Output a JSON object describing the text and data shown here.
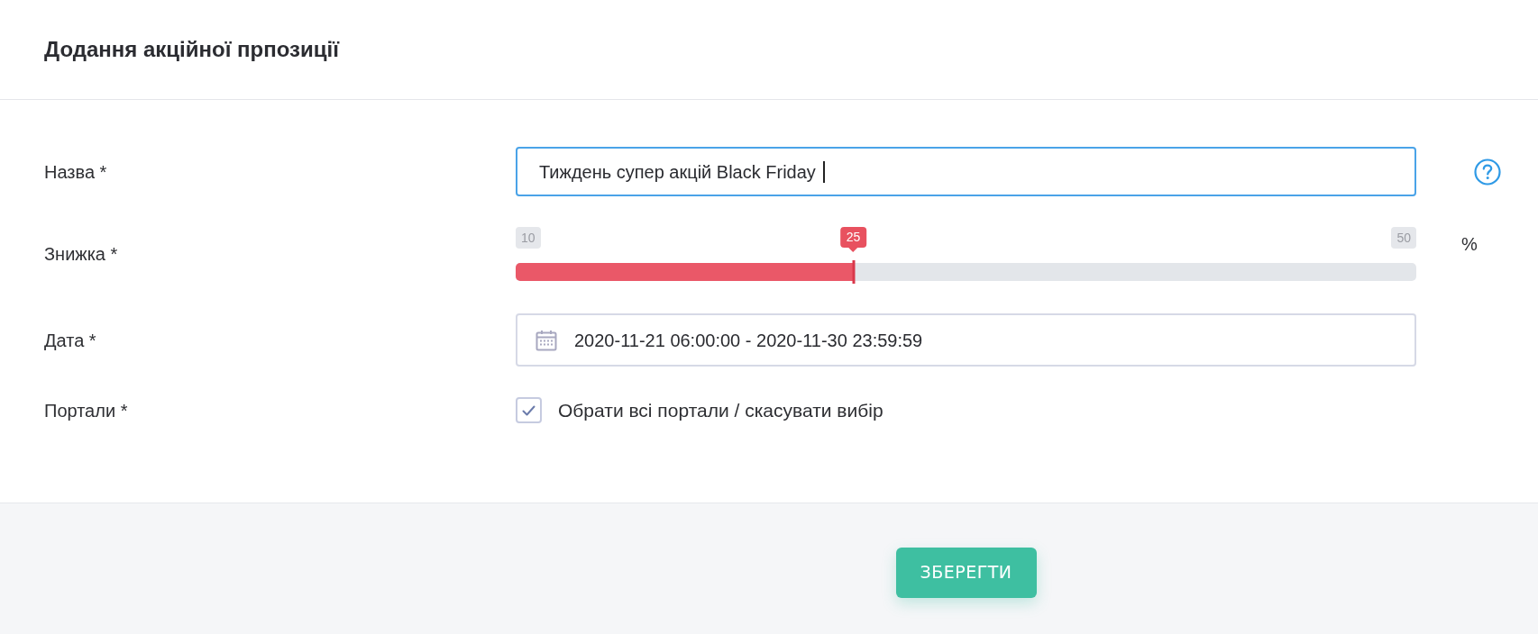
{
  "header": {
    "title": "Додання акційної прпозиції"
  },
  "fields": [
    {
      "kind": "text",
      "label": "Назва *",
      "value": "Тиждень супер акцій Black Friday",
      "focused": true,
      "help": true
    },
    {
      "kind": "slider",
      "label": "Знижка *",
      "min_label": "10",
      "max_label": "50",
      "value_label": "25",
      "level": 0.375,
      "unit": "%"
    },
    {
      "kind": "daterange",
      "label": "Дата *",
      "value": "2020-11-21 06:00:00 - 2020-11-30 23:59:59"
    },
    {
      "kind": "checkbox",
      "label": "Портали *",
      "option": "Обрати всі портали / скасувати вибір",
      "checked": true
    }
  ],
  "footer": {
    "save_button": "ЗБЕРЕГТИ"
  }
}
